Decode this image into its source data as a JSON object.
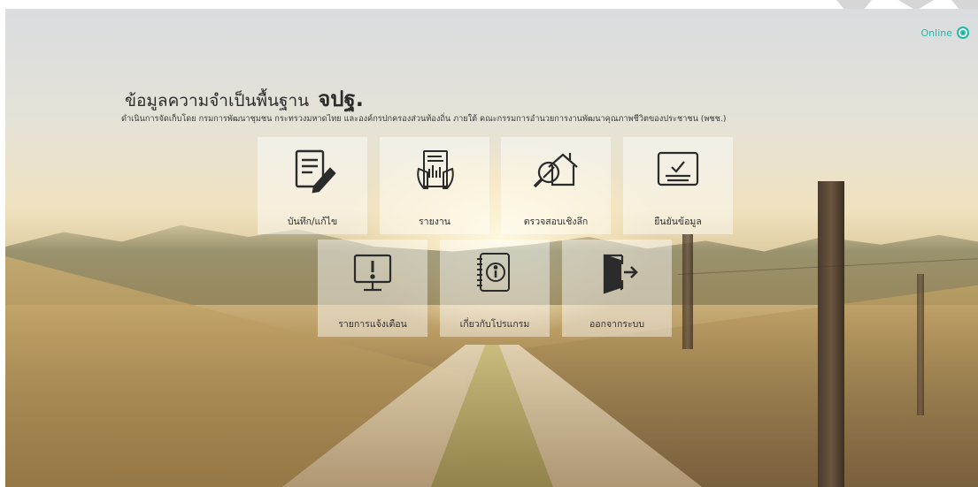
{
  "header": {
    "title": "ข้อมูลความจำเป็นพื้นฐาน",
    "brand": "จปฐ.",
    "subtitle": "ดำเนินการจัดเก็บโดย กรมการพัฒนาชุมชน กระทรวงมหาดไทย และองค์กรปกครองส่วนท้องถิ่น ภายใต้ คณะกรรมการอำนวยการงานพัฒนาคุณภาพชีวิตของประชาชน (พชช.)"
  },
  "status": {
    "label": "Online",
    "color": "#1fb9a8"
  },
  "menu": {
    "record": {
      "label": "บันทึก/แก้ไข",
      "icon": "edit-document-icon"
    },
    "report": {
      "label": "รายงาน",
      "icon": "report-icon"
    },
    "inspect": {
      "label": "ตรวจสอบเชิงลึก",
      "icon": "house-inspect-icon"
    },
    "confirm": {
      "label": "ยืนยันข้อมูล",
      "icon": "confirm-check-icon"
    },
    "alerts": {
      "label": "รายการแจ้งเตือน",
      "icon": "alert-monitor-icon"
    },
    "about": {
      "label": "เกี่ยวกับโปรแกรม",
      "icon": "info-notebook-icon"
    },
    "logout": {
      "label": "ออกจากระบบ",
      "icon": "logout-door-icon"
    }
  }
}
